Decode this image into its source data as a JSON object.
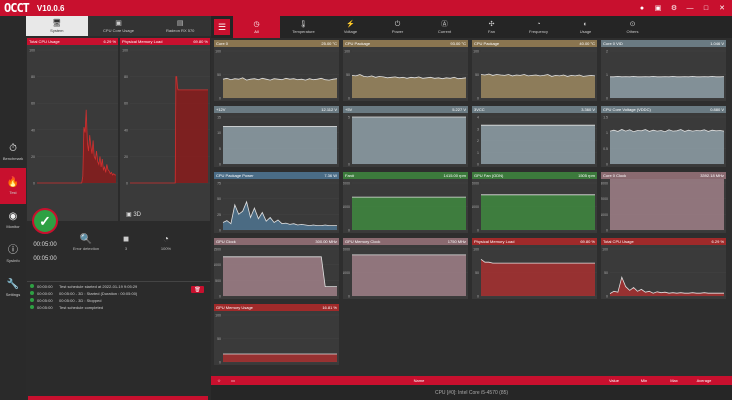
{
  "app": {
    "logo": "OCCT",
    "version": "V10.0.6"
  },
  "sidebar": [
    {
      "name": "benchmark",
      "label": "Benchmark",
      "icon": "⏱",
      "active": false
    },
    {
      "name": "test",
      "label": "Test",
      "icon": "🔥",
      "active": true
    },
    {
      "name": "monitor",
      "label": "Monitor",
      "icon": "◉",
      "active": false
    },
    {
      "name": "sysinfo",
      "label": "SysInfo",
      "icon": "ⓘ",
      "active": false
    },
    {
      "name": "settings",
      "label": "Settings",
      "icon": "🔧",
      "active": false
    }
  ],
  "left_tabs": [
    {
      "label": "System",
      "icon": "🖥",
      "active": true
    },
    {
      "label": "CPU Core Usage",
      "icon": "▣",
      "active": false
    },
    {
      "label": "Radeon RX 570",
      "icon": "▤",
      "active": false
    }
  ],
  "left_charts": [
    {
      "title": "Total CPU Usage",
      "value": "6.29 %",
      "ylim": [
        0,
        100
      ],
      "ticks": [
        "100",
        "80",
        "60",
        "40",
        "20",
        "0"
      ],
      "values": [
        0,
        0,
        0,
        0,
        0,
        0,
        0,
        0,
        0,
        0,
        0,
        0,
        0,
        0,
        0,
        0,
        0,
        0,
        0,
        0,
        0,
        0,
        0,
        0,
        0,
        0,
        0,
        0,
        0,
        0,
        0,
        0,
        0,
        0,
        0,
        0,
        0,
        0,
        0,
        0,
        5,
        42,
        38,
        55,
        30,
        24,
        36,
        28,
        22,
        32,
        20,
        18,
        24,
        16,
        14,
        20,
        12,
        18,
        10,
        12,
        8,
        14,
        10,
        9,
        7,
        8,
        6,
        7,
        6,
        6
      ]
    },
    {
      "title": "Physical Memory Load",
      "value": "69.80 %",
      "ylim": [
        0,
        100
      ],
      "ticks": [
        "100",
        "80",
        "60",
        "40",
        "20",
        "0"
      ],
      "values": [
        0,
        0,
        0,
        0,
        0,
        0,
        0,
        0,
        0,
        0,
        0,
        0,
        0,
        0,
        0,
        0,
        0,
        0,
        0,
        0,
        0,
        0,
        0,
        0,
        0,
        0,
        0,
        0,
        0,
        0,
        0,
        0,
        0,
        0,
        0,
        0,
        0,
        0,
        0,
        0,
        0,
        0,
        0,
        0,
        0,
        0,
        0,
        0,
        0,
        0,
        0,
        0,
        0,
        0,
        0,
        0,
        0,
        0,
        0,
        0,
        0,
        0,
        0,
        80,
        80,
        72,
        70,
        70,
        70,
        70,
        70,
        70,
        70,
        70,
        70,
        70,
        70,
        70,
        70,
        70,
        70,
        70,
        70,
        70,
        70,
        70,
        70,
        70,
        70,
        70,
        70,
        70,
        70,
        70,
        70,
        70,
        70,
        70,
        70,
        70,
        70,
        70,
        70,
        70,
        70,
        70,
        70,
        70
      ]
    }
  ],
  "test": {
    "mode": "3D",
    "elapsed": "00:05:00",
    "duration": "00:05:00",
    "stats": [
      {
        "label": "Error detection",
        "value": "",
        "icon": "🔍"
      },
      {
        "label": "3",
        "value": "",
        "icon": "■"
      },
      {
        "label": "100%",
        "value": "",
        "icon": "◔"
      }
    ]
  },
  "log": [
    {
      "time": "00:00:00",
      "text": "Test schedule started at 2022-01-19 9:05:29"
    },
    {
      "time": "00:00:00",
      "text": "00:05:00 - 3D : Started (Duration : 00:05:00)"
    },
    {
      "time": "00:05:00",
      "text": "00:05:00 - 3D : Stopped"
    },
    {
      "time": "00:05:00",
      "text": "Test schedule completed"
    }
  ],
  "start_button": "↲",
  "right_tabs": [
    {
      "label": "All",
      "icon": "◷",
      "active": true
    },
    {
      "label": "Temperature",
      "icon": "🌡",
      "active": false
    },
    {
      "label": "Voltage",
      "icon": "⚡",
      "active": false
    },
    {
      "label": "Power",
      "icon": "⏻",
      "active": false
    },
    {
      "label": "Current",
      "icon": "Ⓐ",
      "active": false
    },
    {
      "label": "Fan",
      "icon": "✣",
      "active": false
    },
    {
      "label": "Frequency",
      "icon": "◔",
      "active": false
    },
    {
      "label": "Usage",
      "icon": "◐",
      "active": false
    },
    {
      "label": "Others",
      "icon": "⊙",
      "active": false
    }
  ],
  "tiles": [
    {
      "title": "Core 0",
      "value": "25.00 °C",
      "color": "#8a7550",
      "hdr": "#8a7550",
      "fill": "#9c8860",
      "ylim": [
        0,
        100
      ],
      "ticks": [
        "100",
        "50",
        "0"
      ],
      "values": [
        40,
        42,
        39,
        41,
        40,
        43,
        38,
        40,
        41,
        39,
        42,
        40,
        38,
        41,
        40,
        39,
        42,
        40,
        41,
        39,
        40,
        38,
        41,
        39,
        40,
        42,
        39,
        38,
        40,
        41
      ]
    },
    {
      "title": "CPU Package",
      "value": "93.00 °C",
      "color": "#8a7550",
      "hdr": "#8a7550",
      "fill": "#9c8860",
      "ylim": [
        0,
        100
      ],
      "ticks": [
        "100",
        "50",
        "0"
      ],
      "values": [
        48,
        47,
        50,
        46,
        45,
        47,
        44,
        46,
        45,
        43,
        44,
        45,
        43,
        44,
        42,
        44,
        43,
        45,
        42,
        43,
        44,
        42,
        43,
        41,
        43,
        42,
        44,
        41,
        42,
        43
      ]
    },
    {
      "title": "CPU Package",
      "value": "40.00 °C",
      "color": "#8a7550",
      "hdr": "#8a7550",
      "fill": "#9c8860",
      "ylim": [
        0,
        100
      ],
      "ticks": [
        "100",
        "50",
        "0"
      ],
      "values": [
        50,
        49,
        51,
        48,
        50,
        49,
        48,
        50,
        47,
        49,
        48,
        50,
        47,
        48,
        49,
        47,
        48,
        50,
        46,
        48,
        47,
        49,
        46,
        48,
        47,
        49,
        46,
        47,
        48,
        47
      ]
    },
    {
      "title": "Core 0 VID",
      "value": "1.046 V",
      "color": "#6a7a82",
      "hdr": "#6a7a82",
      "fill": "#8fa0a8",
      "ylim": [
        0,
        2
      ],
      "ticks": [
        "2",
        "1",
        "0"
      ],
      "values": [
        0.9,
        0.9,
        0.92,
        0.9,
        0.91,
        0.9,
        0.92,
        0.9,
        0.9,
        0.91,
        0.9,
        0.92,
        0.9,
        0.9,
        0.91,
        0.9,
        0.92,
        0.9,
        0.9,
        0.91,
        0.9,
        0.92,
        0.9,
        0.9,
        0.91,
        0.9,
        0.92,
        0.9,
        0.9,
        0.91
      ]
    },
    {
      "title": "+12V",
      "value": "12.112 V",
      "color": "#6a7a82",
      "hdr": "#6a7a82",
      "fill": "#8fa0a8",
      "ylim": [
        0,
        15
      ],
      "ticks": [
        "15",
        "10",
        "5",
        "0"
      ],
      "values": [
        12,
        12,
        12,
        12,
        12,
        12,
        12,
        12,
        12,
        12,
        12,
        12,
        12,
        12,
        12,
        12,
        12,
        12,
        12,
        12,
        12,
        12,
        12,
        12,
        12,
        12,
        12,
        12,
        12,
        12
      ]
    },
    {
      "title": "+5V",
      "value": "5.227 V",
      "color": "#6a7a82",
      "hdr": "#6a7a82",
      "fill": "#8fa0a8",
      "ylim": [
        0,
        5
      ],
      "ticks": [
        "5",
        "0"
      ],
      "values": [
        5,
        5,
        5,
        5,
        5,
        5,
        5,
        5,
        5,
        5,
        5,
        5,
        5,
        5,
        5,
        5,
        5,
        5,
        5,
        5,
        5,
        5,
        5,
        5,
        5,
        5,
        5,
        5,
        5,
        5
      ]
    },
    {
      "title": "3VCC",
      "value": "3.360 V",
      "color": "#6a7a82",
      "hdr": "#6a7a82",
      "fill": "#8fa0a8",
      "ylim": [
        0,
        4
      ],
      "ticks": [
        "4",
        "3",
        "2",
        "1",
        "0"
      ],
      "values": [
        3.3,
        3.3,
        3.3,
        3.3,
        3.3,
        3.3,
        3.3,
        3.3,
        3.3,
        3.3,
        3.3,
        3.3,
        3.3,
        3.3,
        3.3,
        3.3,
        3.3,
        3.3,
        3.3,
        3.3,
        3.3,
        3.3,
        3.3,
        3.3,
        3.3,
        3.3,
        3.3,
        3.3,
        3.3,
        3.3
      ]
    },
    {
      "title": "CPU Core Voltage (VDDC)",
      "value": "0.880 V",
      "color": "#6a7a82",
      "hdr": "#6a7a82",
      "fill": "#8fa0a8",
      "ylim": [
        0,
        1.5
      ],
      "ticks": [
        "1.5",
        "1",
        "0.5",
        "0"
      ],
      "values": [
        1.05,
        1.08,
        1.04,
        1.1,
        1.05,
        1.09,
        1.03,
        1.07,
        1.06,
        1.1,
        1.04,
        1.08,
        1.05,
        1.07,
        1.03,
        1.09,
        1.05,
        1.06,
        1.1,
        1.04,
        1.08,
        1.05,
        1.07,
        1.06,
        1.09,
        1.04,
        1.08,
        1.06,
        1.07,
        1.05
      ]
    },
    {
      "title": "CPU Package Power",
      "value": "7.36 W",
      "color": "#4a6c86",
      "hdr": "#4a6c86",
      "fill": "#4f7490",
      "ylim": [
        0,
        75
      ],
      "ticks": [
        "75",
        "50",
        "25",
        "0"
      ],
      "values": [
        12,
        15,
        10,
        40,
        25,
        30,
        45,
        20,
        35,
        18,
        28,
        14,
        20,
        12,
        16,
        10,
        11,
        9,
        10,
        8,
        9,
        8,
        7,
        8,
        7,
        7,
        8,
        7,
        7,
        7
      ]
    },
    {
      "title": "Fan#",
      "value": "1415.00 rpm",
      "color": "#3c7a3c",
      "hdr": "#3c7a3c",
      "fill": "#3f8a3f",
      "ylim": [
        0,
        2000
      ],
      "ticks": [
        "2000",
        "1000",
        "0"
      ],
      "values": [
        1400,
        1400,
        1400,
        1400,
        1400,
        1400,
        1400,
        1400,
        1400,
        1400,
        1400,
        1400,
        1400,
        1400,
        1400,
        1400,
        1400,
        1400,
        1400,
        1400,
        1400,
        1400,
        1400,
        1400,
        1400,
        1400,
        1400,
        1400,
        1400,
        1400
      ]
    },
    {
      "title": "GPU Fan (ODN)",
      "value": "1505 rpm",
      "color": "#3c7a3c",
      "hdr": "#3c7a3c",
      "fill": "#3f8a3f",
      "ylim": [
        0,
        2000
      ],
      "ticks": [
        "2000",
        "1000",
        "0"
      ],
      "values": [
        1500,
        1500,
        1500,
        1500,
        1500,
        1500,
        1500,
        1500,
        1500,
        1500,
        1500,
        1500,
        1500,
        1500,
        1500,
        1500,
        1500,
        1500,
        1500,
        1500,
        1500,
        1500,
        1500,
        1500,
        1500,
        1500,
        1500,
        1500,
        1500,
        1500
      ]
    },
    {
      "title": "Core 0 Clock",
      "value": "3392.18 MHz",
      "color": "#8a6a70",
      "hdr": "#8a6a70",
      "fill": "#a08088",
      "ylim": [
        0,
        3000
      ],
      "ticks": [
        "3000",
        "2000",
        "1000",
        "0"
      ],
      "values": [
        3400,
        3390,
        3395,
        3400,
        3392,
        3400,
        3390,
        3398,
        3400,
        3392,
        3395,
        3400,
        3390,
        3398,
        3400,
        3392,
        3395,
        3400,
        3390,
        3398,
        3400,
        3392,
        3395,
        3400,
        3390,
        3398,
        3400,
        3392,
        3395,
        3400
      ]
    },
    {
      "title": "GPU Clock",
      "value": "300.00 MHz",
      "color": "#8a6a70",
      "hdr": "#8a6a70",
      "fill": "#a08088",
      "ylim": [
        0,
        1500
      ],
      "ticks": [
        "1500",
        "1000",
        "500",
        "0"
      ],
      "values": [
        1250,
        1250,
        1250,
        1250,
        1250,
        1250,
        1250,
        1250,
        1250,
        1250,
        1250,
        1250,
        1250,
        1250,
        1250,
        1250,
        1250,
        1250,
        1250,
        1250,
        1250,
        1250,
        1250,
        1250,
        1250,
        1250,
        300,
        300,
        300,
        300
      ]
    },
    {
      "title": "GPU Memory Clock",
      "value": "1750 MHz",
      "color": "#8a6a70",
      "hdr": "#8a6a70",
      "fill": "#a08088",
      "ylim": [
        0,
        2000
      ],
      "ticks": [
        "2000",
        "1000",
        "0"
      ],
      "values": [
        1750,
        1750,
        1750,
        1750,
        1750,
        1750,
        1750,
        1750,
        1750,
        1750,
        1750,
        1750,
        1750,
        1750,
        1750,
        1750,
        1750,
        1750,
        1750,
        1750,
        1750,
        1750,
        1750,
        1750,
        1750,
        1750,
        1750,
        1750,
        1750,
        1750
      ]
    },
    {
      "title": "Physical Memory Load",
      "value": "69.80 %",
      "color": "#a02a2a",
      "hdr": "#a02a2a",
      "fill": "#a83030",
      "ylim": [
        0,
        100
      ],
      "ticks": [
        "100",
        "50",
        "0"
      ],
      "values": [
        78,
        72,
        72,
        70,
        70,
        70,
        70,
        70,
        70,
        70,
        70,
        70,
        70,
        70,
        70,
        70,
        70,
        70,
        70,
        70,
        70,
        70,
        70,
        70,
        70,
        70,
        70,
        70,
        70,
        70
      ]
    },
    {
      "title": "Total CPU Usage",
      "value": "6.29 %",
      "color": "#a02a2a",
      "hdr": "#a02a2a",
      "fill": "#a83030",
      "ylim": [
        0,
        100
      ],
      "ticks": [
        "100",
        "50",
        "0"
      ],
      "values": [
        5,
        10,
        8,
        40,
        20,
        12,
        18,
        10,
        14,
        8,
        10,
        6,
        9,
        7,
        8,
        6,
        7,
        6,
        7,
        6,
        6,
        7,
        6,
        6,
        7,
        6,
        6,
        6,
        6,
        6
      ]
    },
    {
      "title": "GPU Memory Usage",
      "value": "16.81 %",
      "color": "#a02a2a",
      "hdr": "#a02a2a",
      "fill": "#a83030",
      "ylim": [
        0,
        100
      ],
      "ticks": [
        "100",
        "50",
        "0"
      ],
      "values": [
        17,
        17,
        17,
        17,
        17,
        17,
        17,
        17,
        17,
        17,
        17,
        17,
        17,
        17,
        17,
        17,
        17,
        17,
        17,
        17,
        17,
        17,
        17,
        17,
        17,
        17,
        17,
        17,
        17,
        17
      ]
    }
  ],
  "table": {
    "columns": [
      "Name",
      "Value",
      "Min",
      "Max",
      "Average"
    ],
    "row": "CPU [#0]: Intel Core i5-4570 (85)"
  }
}
